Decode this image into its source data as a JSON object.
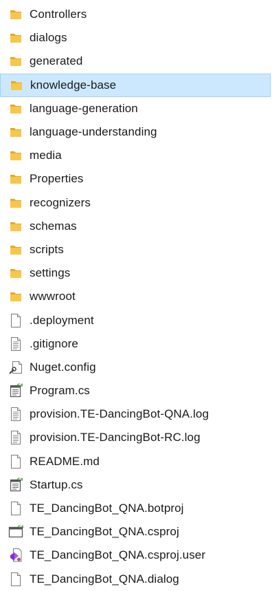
{
  "files": [
    {
      "name": "Controllers",
      "icon": "folder-icon"
    },
    {
      "name": "dialogs",
      "icon": "folder-icon"
    },
    {
      "name": "generated",
      "icon": "folder-icon"
    },
    {
      "name": "knowledge-base",
      "icon": "folder-icon",
      "selected": true
    },
    {
      "name": "language-generation",
      "icon": "folder-icon"
    },
    {
      "name": "language-understanding",
      "icon": "folder-icon"
    },
    {
      "name": "media",
      "icon": "folder-icon"
    },
    {
      "name": "Properties",
      "icon": "folder-icon"
    },
    {
      "name": "recognizers",
      "icon": "folder-icon"
    },
    {
      "name": "schemas",
      "icon": "folder-icon"
    },
    {
      "name": "scripts",
      "icon": "folder-icon"
    },
    {
      "name": "settings",
      "icon": "folder-icon"
    },
    {
      "name": "wwwroot",
      "icon": "folder-icon"
    },
    {
      "name": ".deployment",
      "icon": "blank-file-icon"
    },
    {
      "name": ".gitignore",
      "icon": "text-file-icon"
    },
    {
      "name": "Nuget.config",
      "icon": "config-file-icon"
    },
    {
      "name": "Program.cs",
      "icon": "csharp-file-icon"
    },
    {
      "name": "provision.TE-DancingBot-QNA.log",
      "icon": "text-file-icon"
    },
    {
      "name": "provision.TE-DancingBot-RC.log",
      "icon": "text-file-icon"
    },
    {
      "name": "README.md",
      "icon": "blank-file-icon"
    },
    {
      "name": "Startup.cs",
      "icon": "csharp-file-icon"
    },
    {
      "name": "TE_DancingBot_QNA.botproj",
      "icon": "blank-file-icon"
    },
    {
      "name": "TE_DancingBot_QNA.csproj",
      "icon": "csproj-file-icon"
    },
    {
      "name": "TE_DancingBot_QNA.csproj.user",
      "icon": "vs-user-file-icon"
    },
    {
      "name": "TE_DancingBot_QNA.dialog",
      "icon": "blank-file-icon"
    }
  ],
  "colors": {
    "folder": "#f8c74a",
    "selection_bg": "#cce8ff",
    "selection_border": "#99d1ff",
    "text": "#1a1a1a"
  }
}
